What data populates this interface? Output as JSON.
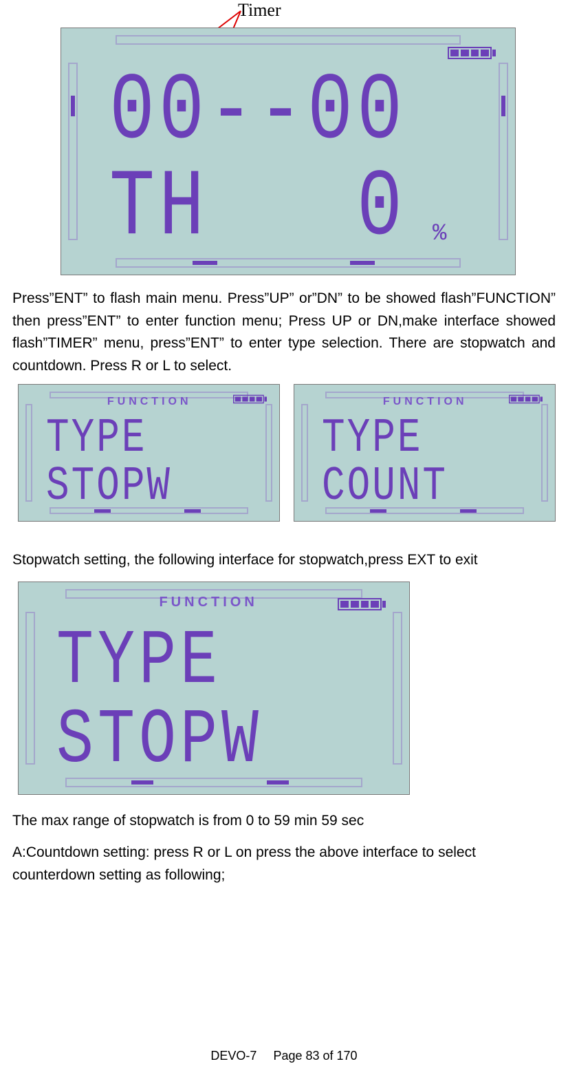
{
  "callout_label": "Timer",
  "lcd1": {
    "line1": "00--00",
    "line2_left": "TH",
    "line2_right": "0",
    "percent": "%"
  },
  "para1": "Press”ENT” to flash main menu. Press”UP” or”DN” to be showed flash”FUNCTION” then press”ENT” to enter function menu; Press UP or DN,make interface showed flash”TIMER” menu, press”ENT” to enter type selection. There are stopwatch and countdown. Press R or L to select.",
  "func_label": "FUNCTION",
  "lcd2a": {
    "line1": "TYPE",
    "line2": "STOPW"
  },
  "lcd2b": {
    "line1": "TYPE",
    "line2": "COUNT"
  },
  "para2": "Stopwatch setting, the following interface for stopwatch,press EXT to exit",
  "lcd3": {
    "line1": "TYPE",
    "line2": "STOPW"
  },
  "para3": "The max range of stopwatch is from 0 to 59 min 59 sec",
  "para4": "A:Countdown setting: press R or L on press the above interface to select counterdown setting as following;",
  "footer_model": "DEVO-7",
  "footer_page": "Page 83 of 170"
}
